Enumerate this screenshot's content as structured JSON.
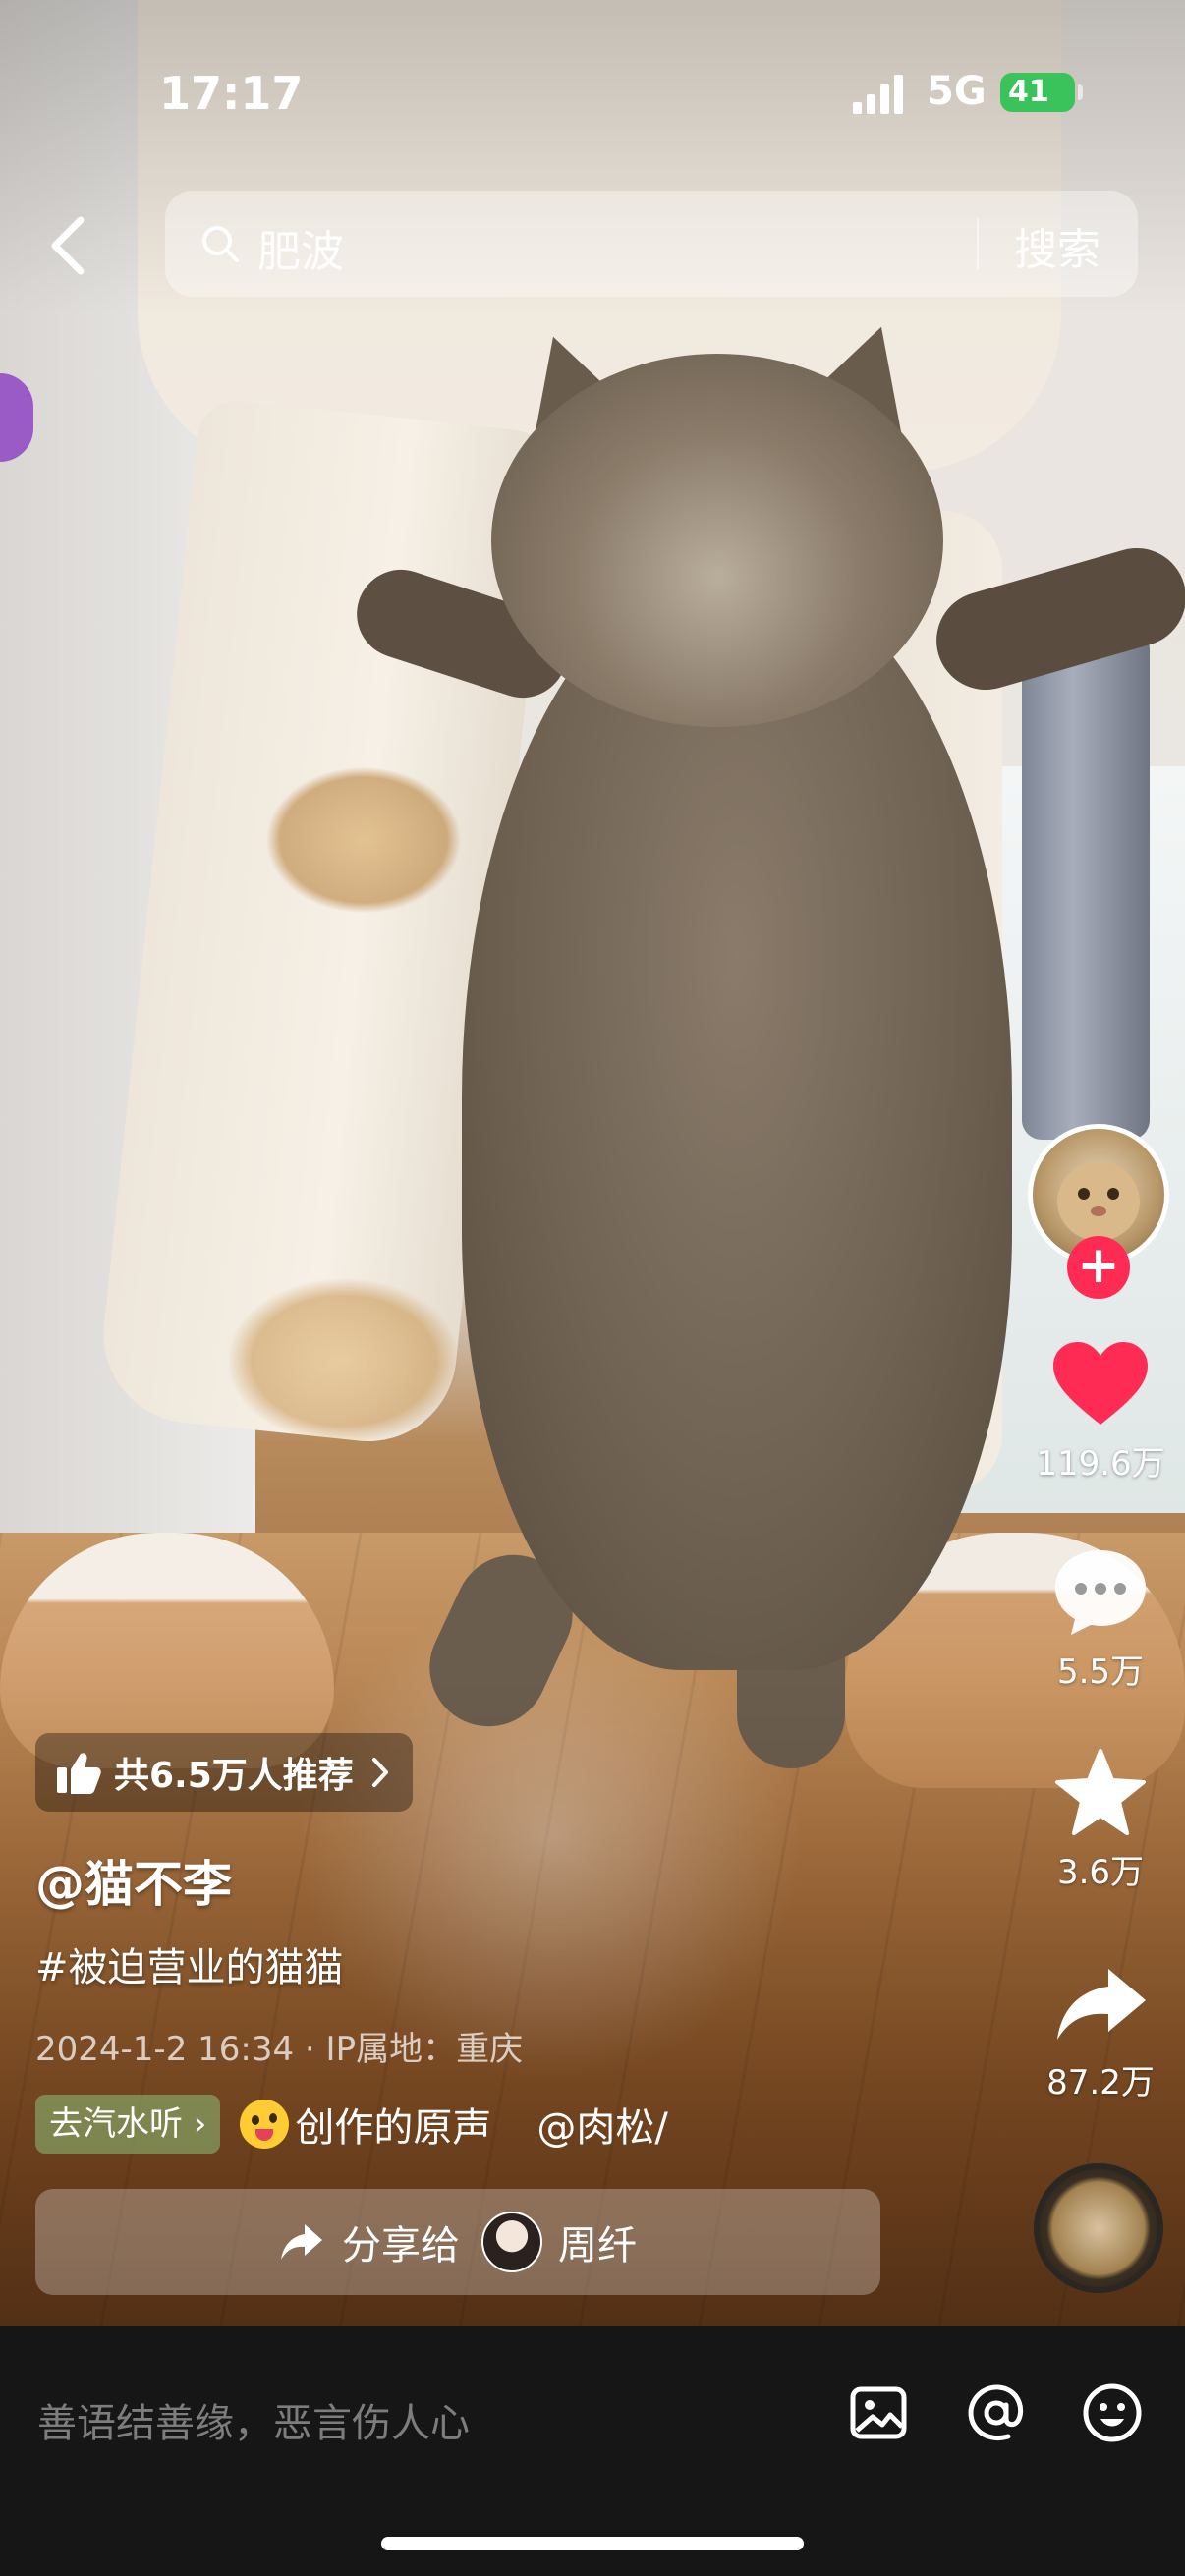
{
  "status_bar": {
    "time": "17:17",
    "network": "5G",
    "battery": "41"
  },
  "search": {
    "query": "肥波",
    "button_label": "搜索"
  },
  "sidebar": {
    "like_count": "119.6万",
    "comment_count": "5.5万",
    "favorite_count": "3.6万",
    "share_count": "87.2万",
    "follow_glyph": "+"
  },
  "video_info": {
    "recommend_text": "共6.5万人推荐",
    "author": "@猫不李",
    "hashtag": "#被迫营业的猫猫",
    "meta": "2024-1-2 16:34 · IP属地：重庆",
    "music": {
      "go_listen_label": "去汽水听 ›",
      "title": "创作的原声",
      "credit": "@肉松/"
    },
    "share": {
      "label": "分享给",
      "friend_name": "周纤"
    }
  },
  "comment_bar": {
    "placeholder": "善语结善缘，恶言伤人心"
  },
  "icons": {
    "back": "chevron-left-icon",
    "search": "search-icon",
    "like": "heart-icon",
    "comment": "comment-bubble-icon",
    "favorite": "star-icon",
    "share": "share-arrow-icon",
    "thumb": "thumbs-up-icon",
    "image": "image-icon",
    "mention": "at-icon",
    "emoji": "emoji-icon"
  },
  "colors": {
    "like_red": "#fe2c55",
    "battery_green": "#3ac35a",
    "bottom_bar": "#161616"
  }
}
